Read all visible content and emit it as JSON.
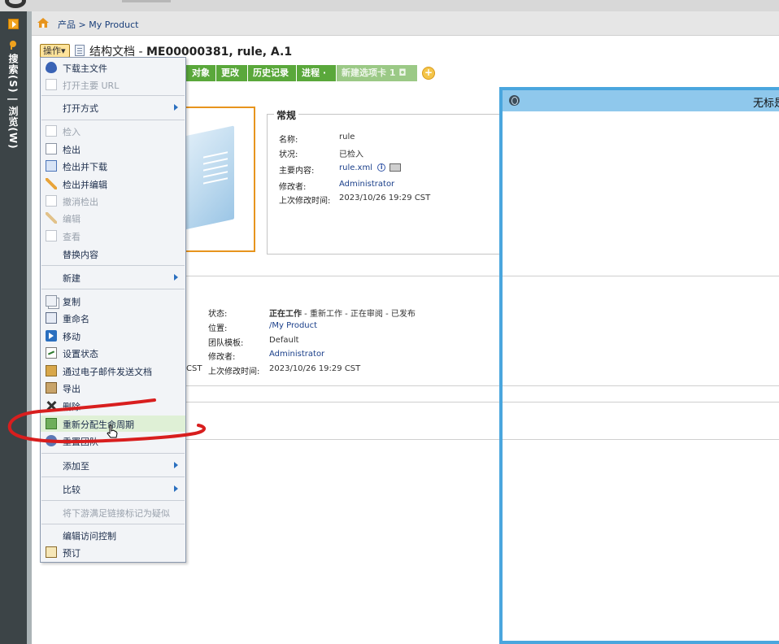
{
  "rail": {
    "label": "搜索(S) | 浏览(W)"
  },
  "breadcrumb": {
    "text": "产品 > My Product"
  },
  "header": {
    "action_label": "操作▾",
    "title_prefix": "结构文档 - ",
    "title_bold": "ME00000381, rule, A.1"
  },
  "tabs": [
    {
      "label": "对象"
    },
    {
      "label": "更改"
    },
    {
      "label": "历史记录"
    },
    {
      "label": "进程 ·"
    },
    {
      "label": "新建选项卡 1 ◘"
    }
  ],
  "general": {
    "legend": "常规",
    "rows": [
      {
        "label": "名称:",
        "value": "rule"
      },
      {
        "label": "状况:",
        "value": "已检入"
      },
      {
        "label": "主要内容:",
        "value": "rule.xml"
      },
      {
        "label": "修改者:",
        "value": "Administrator"
      },
      {
        "label": "上次修改时间:",
        "value": "2023/10/26 19:29 CST"
      }
    ]
  },
  "lower": {
    "state_label": "状态:",
    "state_current": "正在工作",
    "state_rest": " - 重新工作 - 正在审阅 - 已发布",
    "location_label": "位置:",
    "location_value": "/My Product",
    "team_label": "团队模板:",
    "team_value": "Default",
    "modifier_label": "修改者:",
    "modifier_value": "Administrator",
    "clipped_prefix": "CST",
    "modtime_label": "上次修改时间:",
    "modtime_value": "2023/10/26 19:29 CST"
  },
  "right_panel": {
    "title": "无标是"
  },
  "menu": {
    "items": [
      {
        "label": "下载主文件"
      },
      {
        "label": "打开主要 URL"
      },
      {
        "label": "打开方式"
      },
      {
        "label": "检入"
      },
      {
        "label": "检出"
      },
      {
        "label": "检出并下载"
      },
      {
        "label": "检出并编辑"
      },
      {
        "label": "撤消检出"
      },
      {
        "label": "编辑"
      },
      {
        "label": "查看"
      },
      {
        "label": "替换内容"
      },
      {
        "label": "新建"
      },
      {
        "label": "复制"
      },
      {
        "label": "重命名"
      },
      {
        "label": "移动"
      },
      {
        "label": "设置状态"
      },
      {
        "label": "通过电子邮件发送文档"
      },
      {
        "label": "导出"
      },
      {
        "label": "删除"
      },
      {
        "label": "重新分配生命周期"
      },
      {
        "label": "重置团队"
      },
      {
        "label": "添加至"
      },
      {
        "label": "比较"
      },
      {
        "label": "将下游满足链接标记为疑似"
      },
      {
        "label": "编辑访问控制"
      },
      {
        "label": "预订"
      }
    ]
  },
  "colors": {
    "tab_green": "#5aa83b",
    "accent_orange": "#e7941d",
    "panel_blue": "#4aa6de",
    "annotation_red": "#d81e1e"
  }
}
